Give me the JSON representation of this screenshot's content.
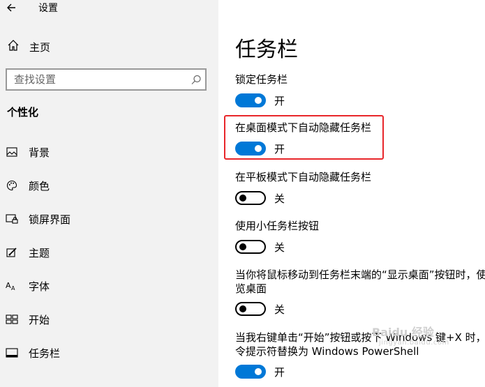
{
  "window": {
    "title": "设置",
    "back_icon": "back-arrow-icon"
  },
  "sidebar": {
    "home_label": "主页",
    "search": {
      "placeholder": "查找设置",
      "icon": "search-icon"
    },
    "section_title": "个性化",
    "items": [
      {
        "label": "背景",
        "icon": "picture-icon"
      },
      {
        "label": "颜色",
        "icon": "palette-icon"
      },
      {
        "label": "锁屏界面",
        "icon": "lock-screen-icon"
      },
      {
        "label": "主题",
        "icon": "theme-brush-icon"
      },
      {
        "label": "字体",
        "icon": "font-icon"
      },
      {
        "label": "开始",
        "icon": "start-tiles-icon"
      },
      {
        "label": "任务栏",
        "icon": "taskbar-icon"
      }
    ]
  },
  "main": {
    "title": "任务栏",
    "settings": [
      {
        "label": "锁定任务栏",
        "state": "开",
        "on": true
      },
      {
        "label": "在桌面模式下自动隐藏任务栏",
        "state": "开",
        "on": true,
        "highlighted": true
      },
      {
        "label": "在平板模式下自动隐藏任务栏",
        "state": "关",
        "on": false
      },
      {
        "label": "使用小任务栏按钮",
        "state": "关",
        "on": false
      },
      {
        "label_line1": "当你将鼠标移动到任务栏末端的“显示桌面”按钮时，使用",
        "label_line2": "览桌面",
        "state": "关",
        "on": false
      },
      {
        "label_line1": "当我右键单击“开始”按钮或按下 Windows 键+X 时，在",
        "label_line2": "令提示符替换为 Windows PowerShell",
        "state": "开",
        "on": true
      }
    ],
    "highlight_color": "#e8262a",
    "accent_color": "#0078d7"
  },
  "watermark": {
    "brand": "Baidu 经验",
    "site": "jingyan.baidu.com"
  }
}
